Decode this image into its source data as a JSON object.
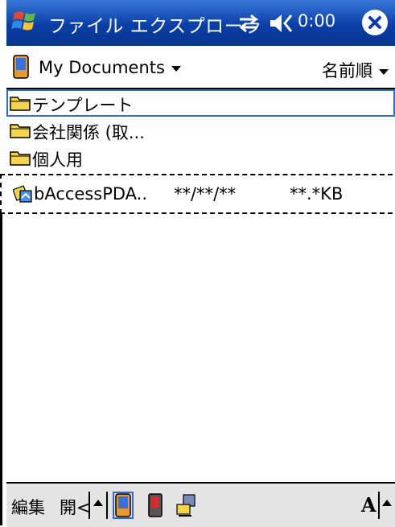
{
  "titlebar": {
    "app_title": "ファイル エクスプローラ",
    "clock": "0:00",
    "close_label": "×"
  },
  "folderbar": {
    "folder_name": "My Documents",
    "sort_label": "名前順"
  },
  "list": {
    "folders": [
      {
        "name": "テンプレート"
      },
      {
        "name": "会社関係 (取..."
      },
      {
        "name": "個人用"
      }
    ],
    "file": {
      "name": "bAccessPDA..",
      "date": "**/**/**",
      "size": "**.*KB"
    }
  },
  "toolbar": {
    "edit_label": "編集",
    "open_label": "開<",
    "font_label": "A"
  },
  "colors": {
    "titlebar": "#0a3fa8",
    "folder_yellow": "#f6d44a",
    "toolbar_bg": "#e4e4e4",
    "selection_outline": "#2f6ad8"
  },
  "icons": [
    "windows-start-icon",
    "sync-icon",
    "speaker-icon",
    "close-icon",
    "pda-icon",
    "folder-icon",
    "app-file-icon",
    "up-arrow-icon",
    "storage-card-icon",
    "network-icon"
  ]
}
